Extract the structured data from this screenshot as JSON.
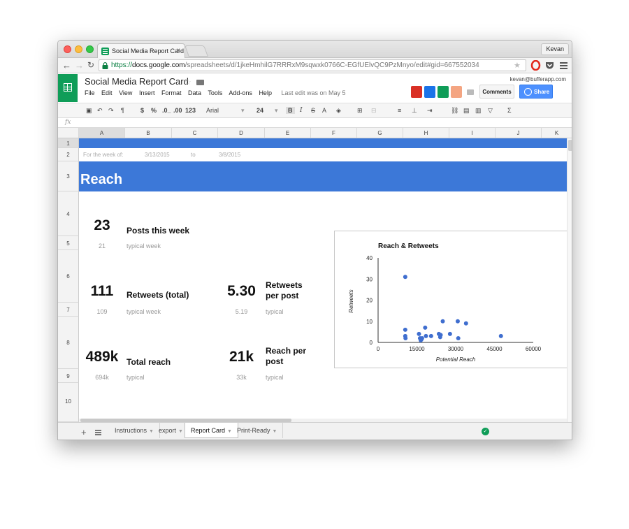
{
  "browser": {
    "tab_title": "Social Media Report Card",
    "tab_close": "×",
    "profile": "Kevan",
    "url": {
      "scheme": "https://",
      "host": "docs.google.com",
      "path": "/spreadsheets/d/1jkeHmhilG7RRRxM9sqwxk0766C-EGfUElvQC9PzMnyo/edit#gid=667552034"
    }
  },
  "docs": {
    "title": "Social Media Report Card",
    "menus": [
      "File",
      "Edit",
      "View",
      "Insert",
      "Format",
      "Data",
      "Tools",
      "Add-ons",
      "Help"
    ],
    "last_edit": "Last edit was on May 5",
    "account": "kevan@bufferapp.com",
    "comments_label": "Comments",
    "share_label": "Share"
  },
  "toolbar": {
    "currency": "$",
    "percent": "%",
    "dec_less": ".0_",
    "dec_more": ".00",
    "more_formats": "123",
    "font": "Arial",
    "font_size": "24",
    "bold": "B",
    "italic": "I",
    "strike": "S",
    "text_color": "A",
    "sigma": "Σ"
  },
  "formula_bar": {
    "fx": "fx"
  },
  "grid": {
    "columns": [
      "A",
      "B",
      "C",
      "D",
      "E",
      "F",
      "G",
      "H",
      "I",
      "J",
      "K"
    ],
    "rows": [
      "1",
      "2",
      "3",
      "4",
      "5",
      "6",
      "7",
      "8",
      "9",
      "10"
    ],
    "row2": {
      "label": "For the week of:",
      "start": "3/13/2015",
      "to": "to",
      "end": "3/8/2015"
    },
    "section_title": "Reach"
  },
  "metrics": {
    "posts": {
      "value": "23",
      "label": "Posts this week",
      "typical_value": "21",
      "typical_label": "typical week"
    },
    "retweets": {
      "value": "111",
      "label": "Retweets (total)",
      "typical_value": "109",
      "typical_label": "typical week"
    },
    "rt_per_post": {
      "value": "5.30",
      "label_1": "Retweets",
      "label_2": "per post",
      "typical_value": "5.19",
      "typical_label": "typical"
    },
    "total_reach": {
      "value": "489k",
      "label": "Total reach",
      "typical_value": "694k",
      "typical_label": "typical"
    },
    "reach_per_post": {
      "value": "21k",
      "label_1": "Reach per",
      "label_2": "post",
      "typical_value": "33k",
      "typical_label": "typical"
    }
  },
  "sheets": {
    "tabs": [
      "Instructions",
      "export",
      "Report Card",
      "Print-Ready"
    ],
    "active": "Report Card"
  },
  "colors": {
    "band": "#3c78d8",
    "point": "#3f6ecf",
    "sheets_green": "#0f9d58"
  },
  "chart_data": {
    "type": "scatter",
    "title": "Reach & Retweets",
    "xlabel": "Potential Reach",
    "ylabel": "Retweets",
    "xlim": [
      0,
      60000
    ],
    "ylim": [
      0,
      40
    ],
    "xticks": [
      0,
      15000,
      30000,
      45000,
      60000
    ],
    "yticks": [
      0,
      10,
      20,
      30,
      40
    ],
    "grid": false,
    "legend": "none",
    "x": [
      10500,
      10500,
      10500,
      10600,
      15800,
      16200,
      16500,
      16800,
      17000,
      18200,
      18500,
      20500,
      23500,
      24000,
      24200,
      25000,
      27800,
      30800,
      31000,
      34000,
      47500
    ],
    "y": [
      31,
      6,
      3,
      2,
      4,
      2,
      1,
      1.5,
      2,
      7,
      3,
      3,
      4,
      2.5,
      3.5,
      10,
      4,
      10,
      2,
      9,
      3
    ]
  }
}
